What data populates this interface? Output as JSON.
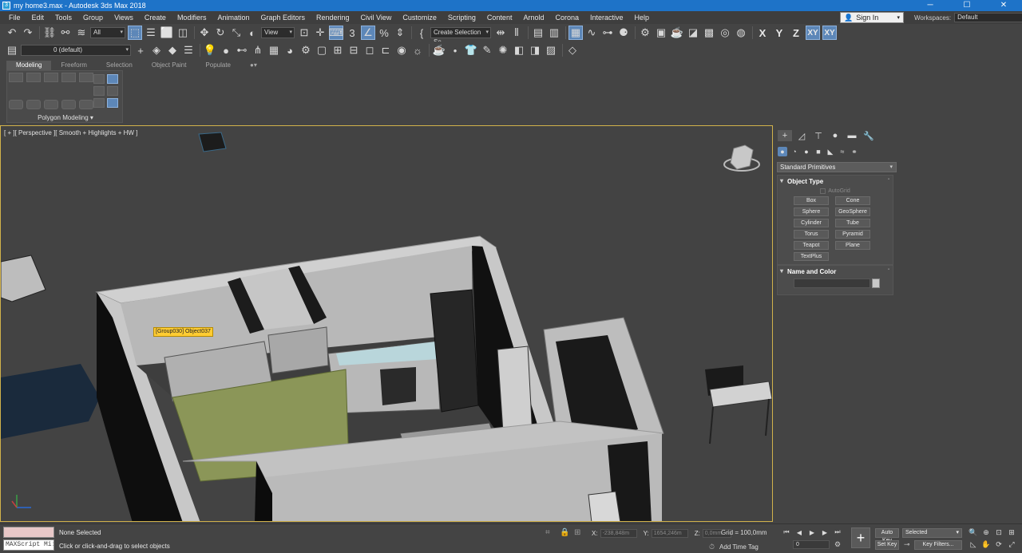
{
  "window": {
    "title": "my home3.max - Autodesk 3ds Max 2018",
    "app_icon": "3ds-max-icon",
    "controls": [
      "minimize",
      "maximize",
      "close"
    ]
  },
  "menubar": {
    "items": [
      "File",
      "Edit",
      "Tools",
      "Group",
      "Views",
      "Create",
      "Modifiers",
      "Animation",
      "Graph Editors",
      "Rendering",
      "Civil View",
      "Customize",
      "Scripting",
      "Content",
      "Arnold",
      "Corona",
      "Interactive",
      "Help"
    ],
    "sign_in": "Sign In",
    "workspaces_label": "Workspaces:",
    "workspaces_value": "Default"
  },
  "main_toolbar": {
    "selection_filter": "All",
    "reference_coord": "View",
    "named_selection": "Create Selection Se",
    "axis_x": "X",
    "axis_y": "Y",
    "axis_z": "Z",
    "axis_xy": "XY",
    "axis_xy2": "XY"
  },
  "layer_toolbar": {
    "layer_value": "0 (default)"
  },
  "ribbon": {
    "tabs": [
      "Modeling",
      "Freeform",
      "Selection",
      "Object Paint",
      "Populate"
    ],
    "active_tab": "Modeling",
    "panel_label": "Polygon Modeling"
  },
  "viewport": {
    "label": "[ + ][ Perspective ][ Smooth + Highlights + HW ]",
    "tooltip": "[Group030] Object037",
    "colors": {
      "border": "#d1b24b",
      "wall": "#c4c4c4",
      "green_wall": "#8b9658",
      "floor": "#3e3e3e"
    }
  },
  "command_panel": {
    "category": "Standard Primitives",
    "object_type_title": "Object Type",
    "autogrid": "AutoGrid",
    "primitives": [
      "Box",
      "Cone",
      "Sphere",
      "GeoSphere",
      "Cylinder",
      "Tube",
      "Torus",
      "Pyramid",
      "Teapot",
      "Plane",
      "TextPlus"
    ],
    "name_color_title": "Name and Color"
  },
  "statusbar": {
    "maxscript": "MAXScript Mi:",
    "selection_status": "None Selected",
    "prompt": "Click or click-and-drag to select objects",
    "x_label": "X:",
    "x_value": "-238,848m",
    "y_label": "Y:",
    "y_value": "1654,246m",
    "z_label": "Z:",
    "z_value": "0,0mm",
    "grid": "Grid = 100,0mm",
    "add_time_tag": "Add Time Tag",
    "frame": "0",
    "auto_key": "Auto Key",
    "set_key": "Set Key",
    "selected": "Selected",
    "key_filters": "Key Filters..."
  }
}
